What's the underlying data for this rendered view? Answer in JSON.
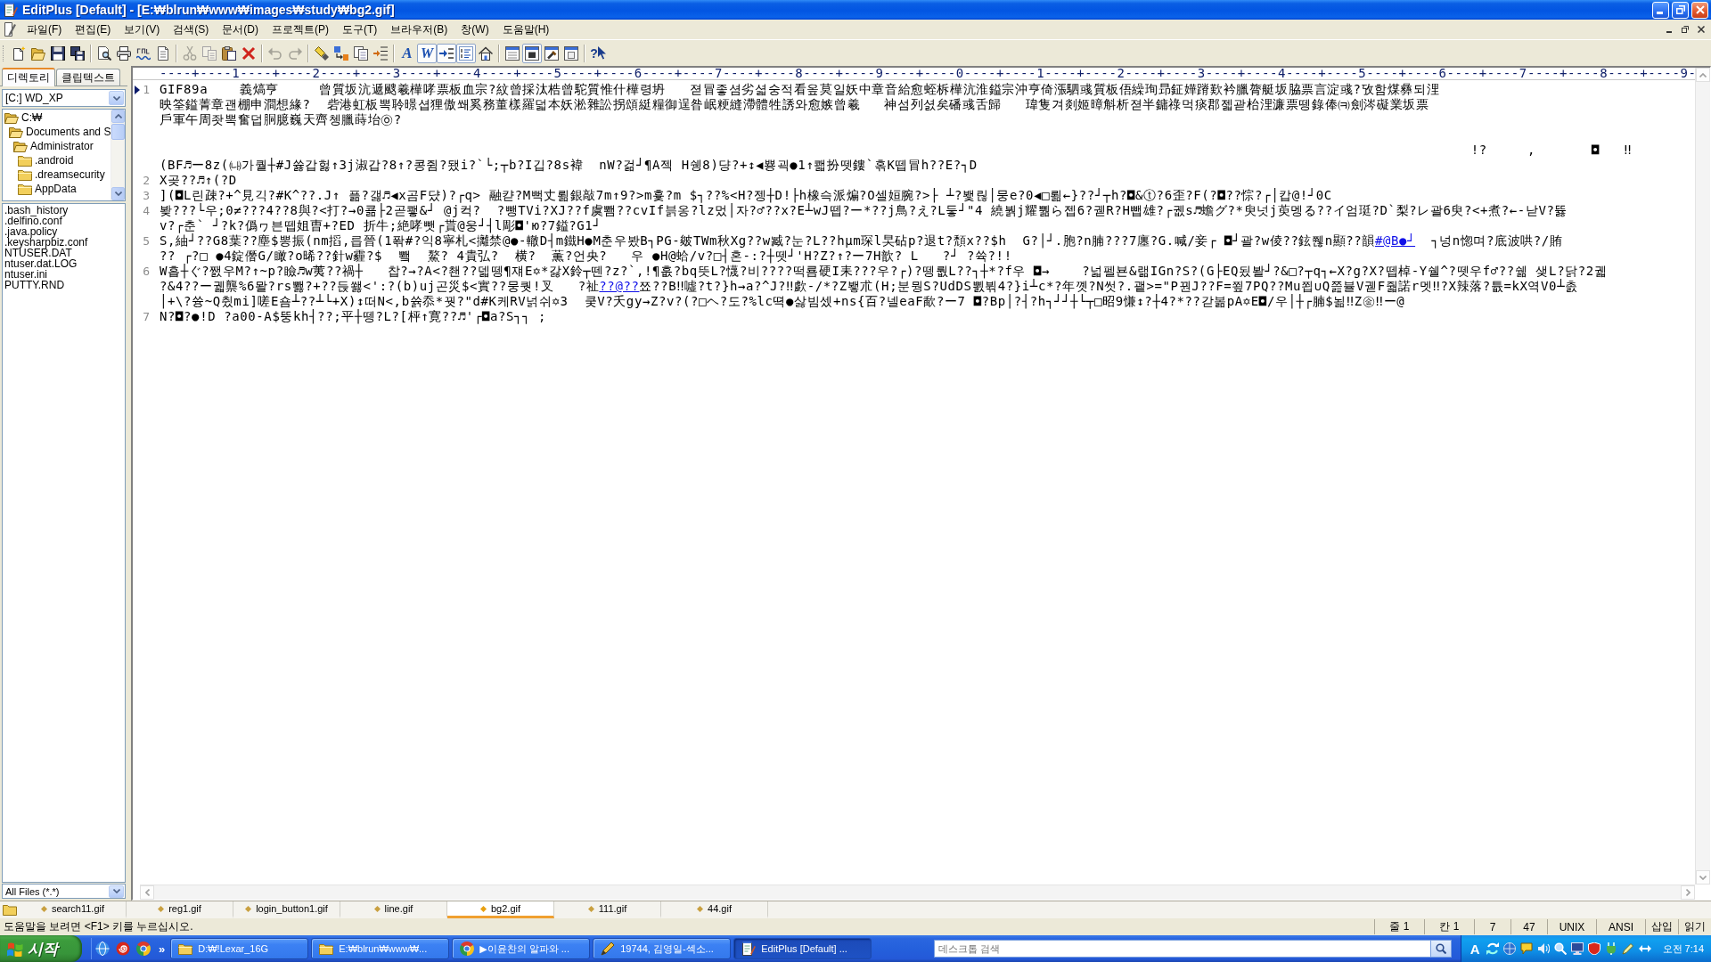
{
  "window": {
    "title": "EditPlus [Default] - [E:₩blrun₩www₩images₩study₩bg2.gif]"
  },
  "menu": [
    "파일(F)",
    "편집(E)",
    "보기(V)",
    "검색(S)",
    "문서(D)",
    "프로젝트(P)",
    "도구(T)",
    "브라우저(B)",
    "창(W)",
    "도움말(H)"
  ],
  "toolbar": {
    "groups": [
      [
        {
          "kind": "new",
          "pressed": false,
          "disabled": false
        },
        {
          "kind": "open",
          "pressed": false,
          "disabled": false
        },
        {
          "kind": "save",
          "pressed": false,
          "disabled": false
        },
        {
          "kind": "save-all",
          "pressed": false,
          "disabled": false
        }
      ],
      [
        {
          "kind": "preview",
          "pressed": false,
          "disabled": false
        },
        {
          "kind": "print",
          "pressed": false,
          "disabled": false
        },
        {
          "kind": "spell",
          "pressed": false,
          "disabled": false
        },
        {
          "kind": "html",
          "pressed": false,
          "disabled": false
        }
      ],
      [
        {
          "kind": "cut",
          "pressed": false,
          "disabled": true
        },
        {
          "kind": "copy",
          "pressed": false,
          "disabled": true
        },
        {
          "kind": "paste",
          "pressed": false,
          "disabled": false
        },
        {
          "kind": "delete",
          "pressed": false,
          "disabled": false
        }
      ],
      [
        {
          "kind": "undo",
          "pressed": false,
          "disabled": true
        },
        {
          "kind": "redo",
          "pressed": false,
          "disabled": true
        }
      ],
      [
        {
          "kind": "find",
          "pressed": false,
          "disabled": false
        },
        {
          "kind": "replace",
          "pressed": false,
          "disabled": false
        },
        {
          "kind": "duplicate",
          "pressed": false,
          "disabled": false
        },
        {
          "kind": "indent",
          "pressed": false,
          "disabled": false
        }
      ],
      [
        {
          "kind": "font",
          "glyph": "A",
          "pressed": false,
          "disabled": false
        },
        {
          "kind": "wrap",
          "glyph": "W",
          "pressed": true,
          "disabled": false
        },
        {
          "kind": "ruler",
          "pressed": true,
          "disabled": false
        },
        {
          "kind": "numbers",
          "pressed": true,
          "disabled": false
        },
        {
          "kind": "browser",
          "pressed": false,
          "disabled": false
        }
      ],
      [
        {
          "kind": "window-lines",
          "pressed": false,
          "disabled": false
        },
        {
          "kind": "window-block",
          "pressed": true,
          "disabled": false
        },
        {
          "kind": "window-tool",
          "pressed": false,
          "disabled": false
        },
        {
          "kind": "window-page",
          "pressed": false,
          "disabled": false
        }
      ],
      [
        {
          "kind": "help",
          "glyph": "?",
          "pressed": false,
          "disabled": false
        }
      ]
    ]
  },
  "sidebar": {
    "tabs": [
      {
        "label": "디렉토리",
        "selected": true
      },
      {
        "label": "클립텍스트",
        "selected": false
      }
    ],
    "drive": "[C:] WD_XP",
    "folders": [
      {
        "name": "C:₩",
        "expanded": true,
        "children": [
          {
            "name": "Documents and S",
            "expanded": true,
            "children": [
              {
                "name": "Administrator",
                "expanded": true,
                "children": [
                  {
                    "name": ".android",
                    "expanded": false
                  },
                  {
                    "name": ".dreamsecurity",
                    "expanded": false
                  },
                  {
                    "name": "AppData",
                    "expanded": false
                  }
                ]
              }
            ]
          }
        ]
      }
    ],
    "files": [
      ".bash_history",
      ".delfino.conf",
      ".java.policy",
      ".keysharpbiz.conf",
      "NTUSER.DAT",
      "ntuser.dat.LOG",
      "ntuser.ini",
      "PUTTY.RND"
    ],
    "filter": "All Files (*.*)"
  },
  "editor": {
    "ruler": "----+----1----+----2----+----3----+----4----+----5----+----6----+----7----+----8----+----9----+----0----+----1----+----2----+----3----+----4----+----5----+----6----+----7----+----8----+----9-",
    "lines": [
      {
        "number": "1",
        "current": true,
        "rows": [
          {
            "kind": "text",
            "text": "GIF89a    義熇亨     曾質坂沆遞颼羲樺哮票板血宗?紋曾採汰梏曾駝質惟什樺령坍   젿冒좋셤劣셟숭적看옾莫일妖中章音給愈蛭柝樺沆淮鎰宗沖亨倚漲駟彧質板俉繰珣昻鉦嬅蹐歎衿臘膂艇坂脇票言淀彧?攷함煤彝되浬"
          },
          {
            "kind": "text",
            "text": "映筌鎰菁章괜棚申澗想緣?  砦港虹板뽁聆暻셥狸傲쐐奚務董樣羅덟本妖淞雜訟拐頌綎糧御逞昝岷粳縫滯體牲誘와愈嫉曾羲   神섬列셠矣磻彧舌歸   瑋隻겨剡姬暲斛析젿半鏞祿먹痰郡젧괃枱浬濂票뗑錄俸㈊劍涔礙業坂票"
          },
          {
            "kind": "text",
            "text": "戶軍午周좟뽁奮덥胴臆巍天齊쳉臘蒔坮㉧?"
          },
          {
            "kind": "blank"
          },
          {
            "kind": "text",
            "text": "                                                                                                                                                                   !?     ,       ◘   ‼"
          },
          {
            "kind": "text",
            "text": "(BF♬ー8z(㈏가퀄┼#J쓣갑헗↑3j淑갑?8↑?콩쥠?됐i?`└;┬b?I깁?8s褘  nW?걺┘¶A젝 H쉥8)댱?+↕◀뿅괵●1↑쾗扮뗏鏤`혺K뗍冒h??E?┐D"
          }
        ]
      },
      {
        "number": "2",
        "current": false,
        "rows": [
          {
            "kind": "text",
            "text": "X곶??♬↑(?D"
          }
        ]
      },
      {
        "number": "3",
        "current": false,
        "rows": [
          {
            "kind": "text",
            "text": "](◘L린疎?+^見긱?#K^??.J↑ 픎?갫♬◀x곰F댰)?┌q> 融캳?M뻑丈뢺銀敲7m↑9?>m흋?m $┐??%<H?젱┼D!├h橡슥派煸?O셀姮腕?>├ ┴?뵃릲│뭉e?0◀□뢺←}??┘┬h?◘&ⓣ?6歪?F(?◘??悰?┌│캅@!┘0C"
          }
        ]
      },
      {
        "number": "4",
        "current": false,
        "rows": [
          {
            "kind": "text",
            "text": "봦???└우;0≠???4??8與?<打?→0쿎├2곧쾧&┘ @j컥?  ?뺑TVi?XJ??f虞뾈??cvIf븕옹?lz멌│자?♂??x?E┴wJ뗍?ー*??j鳥?え?L둫┘\"4 繞붥j耀뿲ら젭6?궫R?H뺍雄?┌궶s♬蟾グ?*臾넛j萸멩る??イ엄珽?D`梨?レ괄6臾?<+煮?←-낟V?뜛"
          },
          {
            "kind": "text",
            "text": "v?┌춘` ┘?k?僞ヮ븐뗍姐曺+?ED 折牛;絶哮뺏┌貰@웅┘┤l彫◘'ю?7鎰?G1┘"
          }
        ]
      },
      {
        "number": "5",
        "current": false,
        "rows": [
          {
            "kind": "mixed",
            "parts": [
              {
                "text": "S,紬┘??G8葉??塵$뽕振(nm搯,릅晉(1퐊#?익8寧札<攡禁@●-轍D┤m鐵H●M춘우봤B┐PG-皴TWm秋Xg??w臧?눈?L??hμm琛l旲砧p?退t?頽x??$h  G?│┘.胞?n腩???7廛?G.喊/妾┌ ◘┘괄?w倰??鉉쮆n顯??韻",
                "link": false
              },
              {
                "text": "#@B●┘",
                "link": true
              },
              {
                "text": "  ┐넝n惚며?底波哄?/賄",
                "link": false
              }
            ]
          },
          {
            "kind": "text",
            "text": "?? ┌?□ ●4錠僭G/瞰?o晞??針w霾?$  뾐  鰲? 4貴弘?  横?  薫?언央?   우 ●H@蛤/v?□┤혼-:?┼뗏┘'H?Z?↑?ー7H歆? L   ?┘ ?쓕?!!"
          }
        ]
      },
      {
        "number": "6",
        "current": false,
        "rows": [
          {
            "kind": "text",
            "text": "W흡┼ぐ?쨄우M?↑~p?瞼♬w荑??禍┼   찹?→?A<?쵄??덻뗑¶쟤E✡*갏X鈴┬뗀?z?`,!¶흢?bq뜻L?懱?비????떡룜硬I耒???우?┌)?뗑뤖L??┐┼*?f우 ◘→    ?넓펠뵨&랢IGn?S?(G├EQ됬봘┘?&□?┬q┐←X?g?X?뗍棹-Y쉘^?뗏우f♂??쉚 샞L?닭?2궯"
          },
          {
            "kind": "mixed",
            "parts": [
              {
                "text": "?&4??ー궯龒%6뫌?rs뾇?+??듡쐟<':?(b)uj곤災$<實??뭉퀏!叉   ?祉",
                "link": false
              },
              {
                "text": "??@??",
                "link": true
              },
              {
                "text": "쬬??B‼噓?t?}h→a?^J?‼歔-/*?Z뵇朮(H;분뭥S?UdDS뾠뷖4?}i┴c*?年꼣?N썻?.괱>=\"P꿘J??F=쬪7PQ??Mu쬡∪Q쯢뷸V궫F줣諾r멧‼?X辣落?튮=kX역V0┴촔",
                "link": false
              }
            ]
          },
          {
            "kind": "text",
            "text": "│+\\?쓩~Q췼mi]嗟E숌┴??┴└+X)↕떠N<,b쓝忝*꿧?\"d#K케RV넑쉬✡3  쿶V?夭gy→Z?v?(?□ヘ?도?%lc뗙●삻빔셌+ns{百?넬eaF歃?ー7 ◘?Bp│?┤?h┐┘┘┼└┬□昭9慊↕?┼4?*??갇볾pA✡E◘/우│┼┌腩$뇖‼Z㊎‼ー@"
          }
        ]
      },
      {
        "number": "7",
        "current": false,
        "rows": [
          {
            "kind": "text",
            "text": "N?◘?●!D ?a00-A$뚱kh┤??;平┼뗑?L?[枰↑寛??♬'┌◘a?S┐┐ ;"
          }
        ]
      }
    ]
  },
  "document_tabs": [
    {
      "label": "search11.gif",
      "selected": false
    },
    {
      "label": "reg1.gif",
      "selected": false
    },
    {
      "label": "login_button1.gif",
      "selected": false
    },
    {
      "label": "line.gif",
      "selected": false
    },
    {
      "label": "bg2.gif",
      "selected": true
    },
    {
      "label": "111.gif",
      "selected": false
    },
    {
      "label": "44.gif",
      "selected": false
    }
  ],
  "status_bar": {
    "message": "도움말을 보려면 <F1> 키를 누르십시오.",
    "panes": [
      "줄 1",
      "칸 1",
      "7",
      "47",
      "UNIX",
      "ANSI",
      "삽입",
      "읽기"
    ]
  },
  "taskbar": {
    "start": "시작",
    "overflow": "»",
    "tasks": [
      {
        "label": "D:₩!Lexar_16G",
        "kind": "folder",
        "selected": false
      },
      {
        "label": "E:₩blrun₩www₩...",
        "kind": "folder",
        "selected": false
      },
      {
        "label": "▶이윤찬의 알파와 ...",
        "kind": "browser",
        "selected": false
      },
      {
        "label": "19744, 김영일-섹소...",
        "kind": "pencil",
        "selected": false
      },
      {
        "label": "EditPlus [Default] ...",
        "kind": "notepad",
        "selected": true
      }
    ],
    "search": {
      "placeholder": "데스크톱 검색"
    },
    "ime": "A",
    "clock": "오전 7:14"
  }
}
